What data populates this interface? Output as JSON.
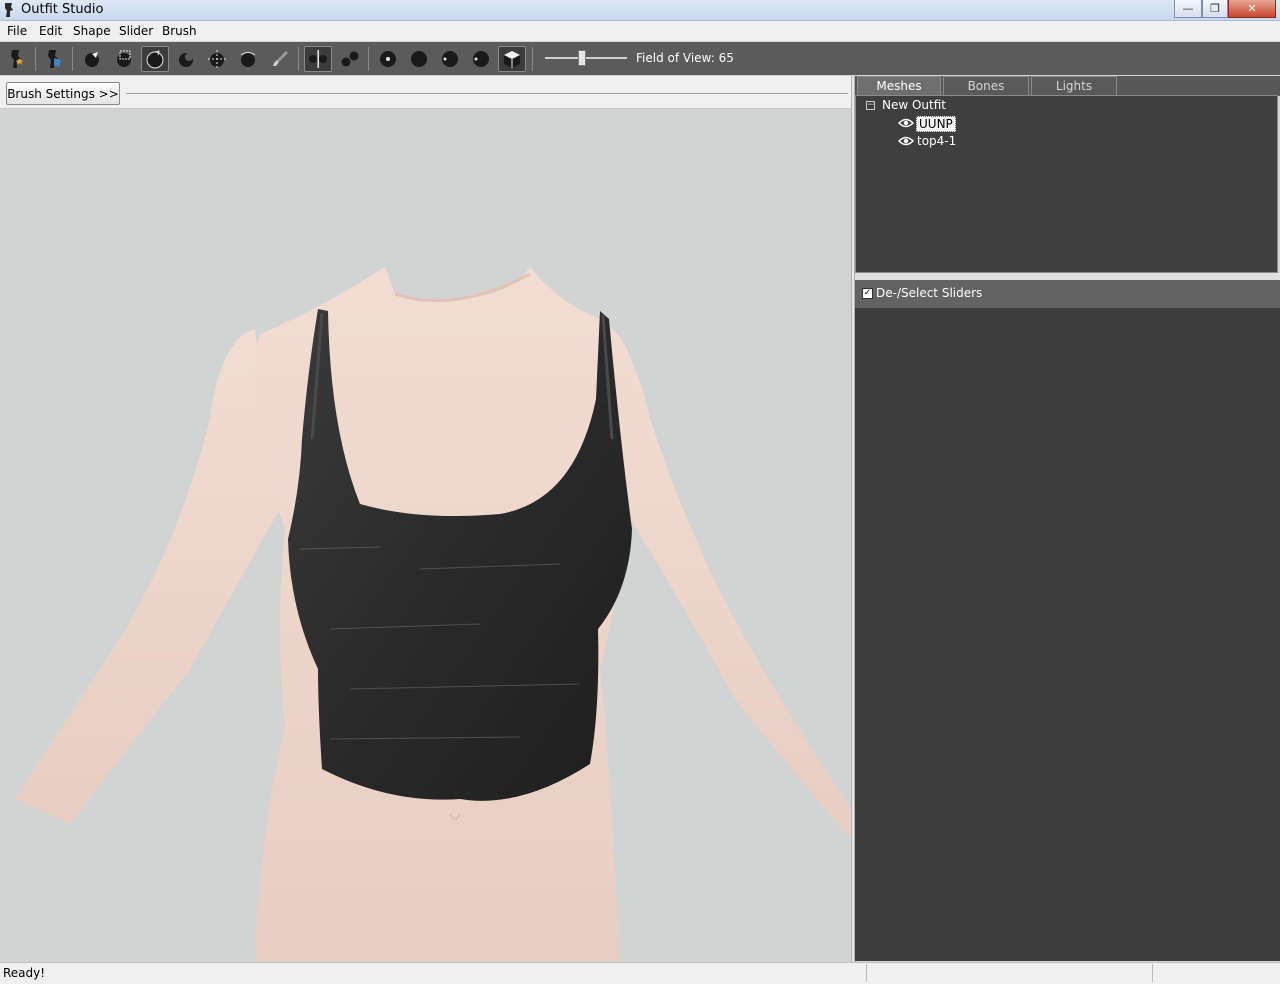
{
  "window": {
    "title": "Outfit Studio"
  },
  "menu": {
    "items": [
      "File",
      "Edit",
      "Shape",
      "Slider",
      "Brush"
    ]
  },
  "toolbar": {
    "fov_label": "Field of View: 65"
  },
  "brush": {
    "settings_label": "Brush Settings >>"
  },
  "panel": {
    "tabs": [
      "Meshes",
      "Bones",
      "Lights"
    ],
    "tree": {
      "root": "New Outfit",
      "meshes": [
        "UUNP",
        "top4-1"
      ]
    }
  },
  "sliders": {
    "header": "De-/Select Sliders"
  },
  "status": {
    "text": "Ready!"
  },
  "colors": {
    "toolbar": "#5b5b5b",
    "panel": "#3f3f3f",
    "viewport": "#d2d3d3"
  }
}
